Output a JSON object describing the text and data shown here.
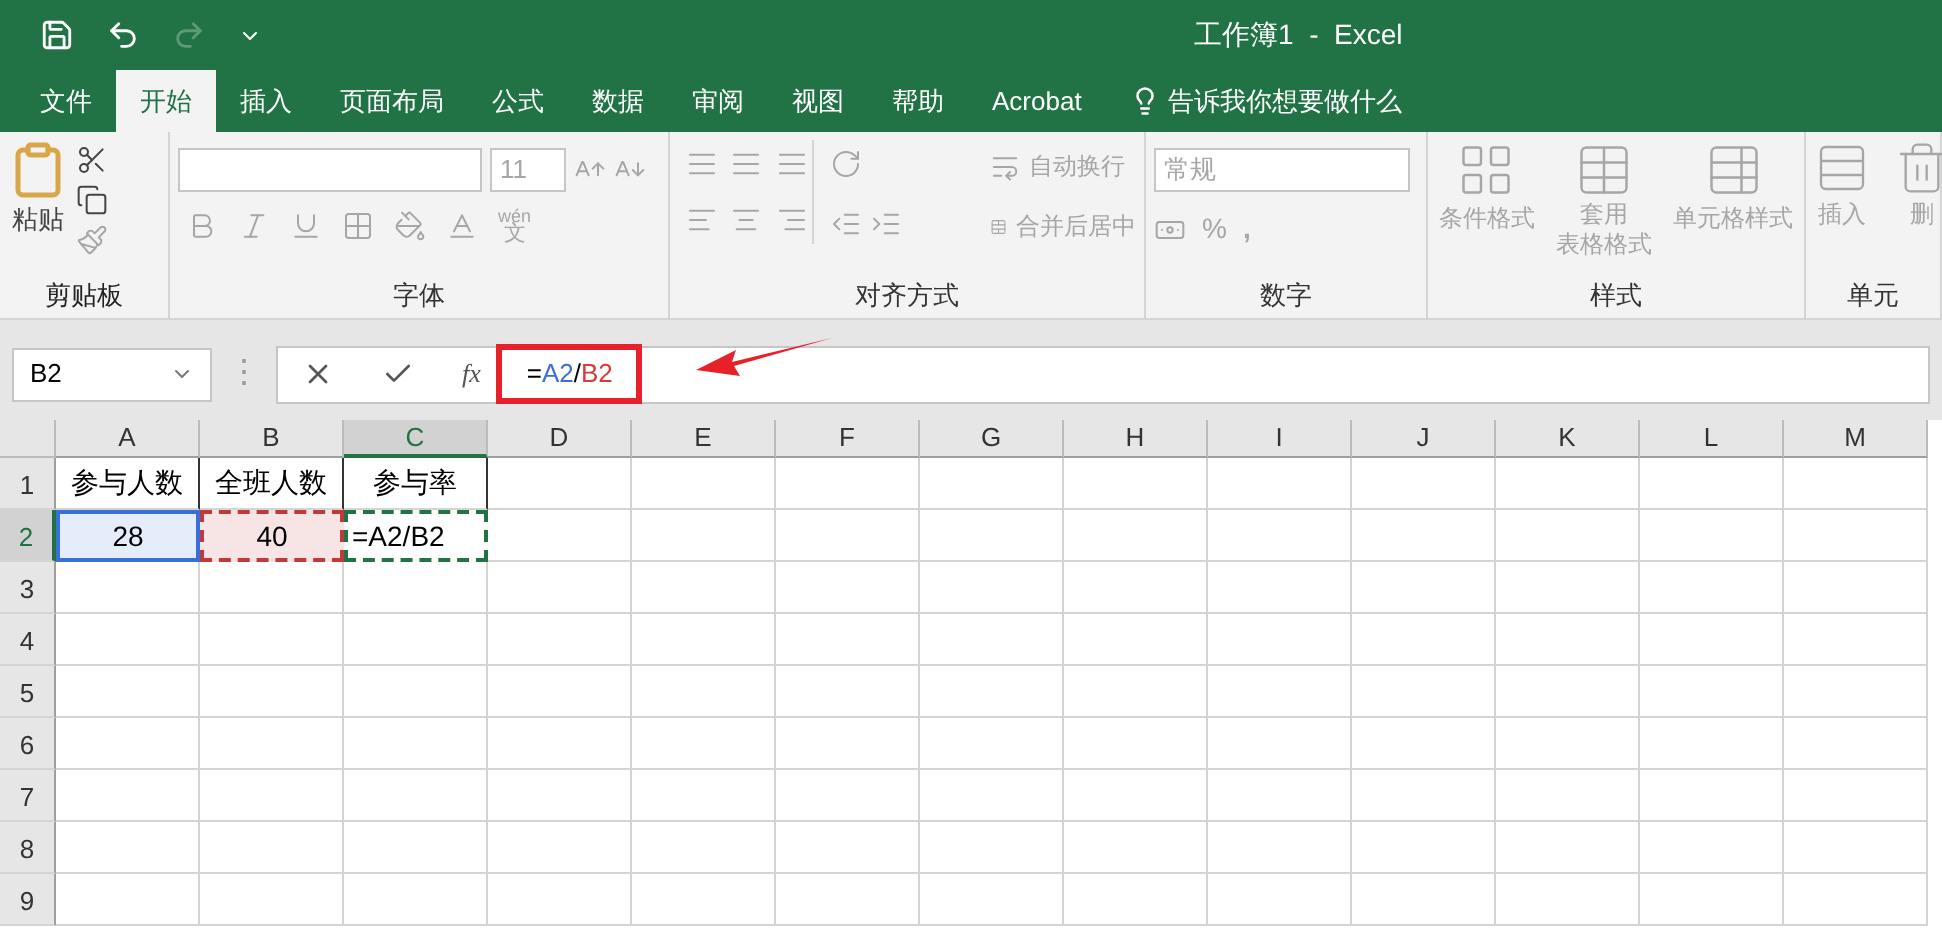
{
  "window": {
    "title": "工作簿1  -  Excel"
  },
  "tabs": [
    {
      "label": "文件",
      "selected": false
    },
    {
      "label": "开始",
      "selected": true
    },
    {
      "label": "插入",
      "selected": false
    },
    {
      "label": "页面布局",
      "selected": false
    },
    {
      "label": "公式",
      "selected": false
    },
    {
      "label": "数据",
      "selected": false
    },
    {
      "label": "审阅",
      "selected": false
    },
    {
      "label": "视图",
      "selected": false
    },
    {
      "label": "帮助",
      "selected": false
    },
    {
      "label": "Acrobat",
      "selected": false
    }
  ],
  "tell_me": {
    "placeholder": "告诉我你想要做什么"
  },
  "ribbon": {
    "clipboard": {
      "label": "剪贴板",
      "paste": "粘贴",
      "disabled": false
    },
    "font": {
      "label": "字体",
      "font_size": "11",
      "phonetic_top": "wén",
      "phonetic_bottom": "文",
      "disabled": true
    },
    "alignment": {
      "label": "对齐方式",
      "wrap_text": "自动换行",
      "merge_center": "合并后居中",
      "disabled": true
    },
    "number": {
      "label": "数字",
      "format": "常规",
      "percent": "%",
      "comma": ",",
      "disabled": true
    },
    "styles": {
      "label": "样式",
      "conditional": "条件格式",
      "table_top": "套用",
      "table_bottom": "表格格式",
      "cell_styles": "单元格样式",
      "disabled": true
    },
    "cells": {
      "label": "单元",
      "insert": "插入",
      "delete": "删",
      "disabled": true
    }
  },
  "formula_bar": {
    "name_box": "B2",
    "separator": "⋮",
    "function_label": "fx",
    "formula": [
      {
        "text": "=",
        "color": "#000000"
      },
      {
        "text": "A2",
        "color": "#3a6fd8"
      },
      {
        "text": "/",
        "color": "#000000"
      },
      {
        "text": "B2",
        "color": "#d83a3a"
      }
    ]
  },
  "columns": [
    {
      "label": "A",
      "selected": false
    },
    {
      "label": "B",
      "selected": false
    },
    {
      "label": "C",
      "selected": true
    },
    {
      "label": "D",
      "selected": false
    },
    {
      "label": "E",
      "selected": false
    },
    {
      "label": "F",
      "selected": false
    },
    {
      "label": "G",
      "selected": false
    },
    {
      "label": "H",
      "selected": false
    },
    {
      "label": "I",
      "selected": false
    },
    {
      "label": "J",
      "selected": false
    },
    {
      "label": "K",
      "selected": false
    },
    {
      "label": "L",
      "selected": false
    },
    {
      "label": "M",
      "selected": false
    }
  ],
  "rows": [
    {
      "label": "1",
      "selected": false,
      "cells": [
        {
          "value": "参与人数"
        },
        {
          "value": "全班人数"
        },
        {
          "value": "参与率"
        }
      ]
    },
    {
      "label": "2",
      "selected": true,
      "cells": [
        {
          "value": "28",
          "color": "#3a6fd8"
        },
        {
          "value": "40",
          "color": "#c0393b"
        },
        {
          "value": "=A2/B2",
          "color": "#217346"
        }
      ]
    },
    {
      "label": "3",
      "selected": false,
      "cells": []
    },
    {
      "label": "4",
      "selected": false,
      "cells": []
    },
    {
      "label": "5",
      "selected": false,
      "cells": []
    },
    {
      "label": "6",
      "selected": false,
      "cells": []
    },
    {
      "label": "7",
      "selected": false,
      "cells": []
    },
    {
      "label": "8",
      "selected": false,
      "cells": []
    },
    {
      "label": "9",
      "selected": false,
      "cells": []
    }
  ]
}
